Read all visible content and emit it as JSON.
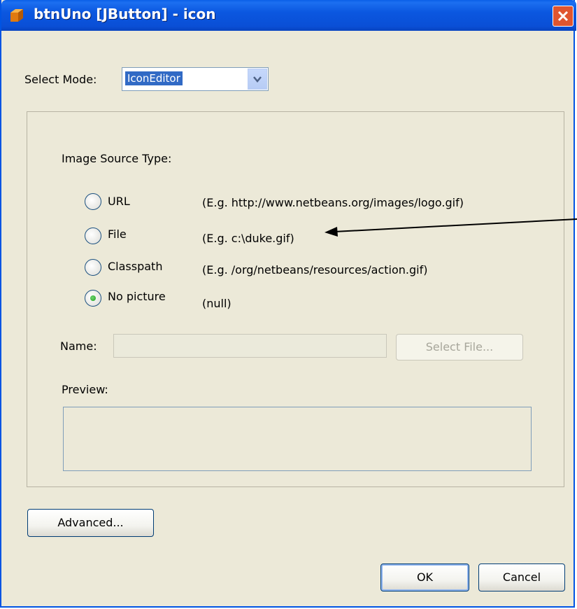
{
  "window": {
    "title": "btnUno [JButton] - icon"
  },
  "select_mode": {
    "label": "Select Mode:",
    "value": "IconEditor"
  },
  "image_source": {
    "heading": "Image Source Type:",
    "options": [
      {
        "label": "URL",
        "example": "(E.g. http://www.netbeans.org/images/logo.gif)",
        "checked": false
      },
      {
        "label": "File",
        "example": "(E.g. c:\\duke.gif)",
        "checked": false
      },
      {
        "label": "Classpath",
        "example": "(E.g. /org/netbeans/resources/action.gif)",
        "checked": false
      },
      {
        "label": "No picture",
        "example": "(null)",
        "checked": true
      }
    ]
  },
  "name_field": {
    "label": "Name:",
    "value": ""
  },
  "select_file_button": "Select File...",
  "preview": {
    "label": "Preview:"
  },
  "advanced_button": "Advanced...",
  "ok_button": "OK",
  "cancel_button": "Cancel",
  "colors": {
    "titlebar": "#0a4fd6",
    "dialog_bg": "#ece9d8",
    "selection": "#316ac5",
    "close": "#e0552f"
  },
  "icons": [
    "window-icon",
    "close-icon",
    "chevron-down-icon",
    "annotation-arrow"
  ]
}
